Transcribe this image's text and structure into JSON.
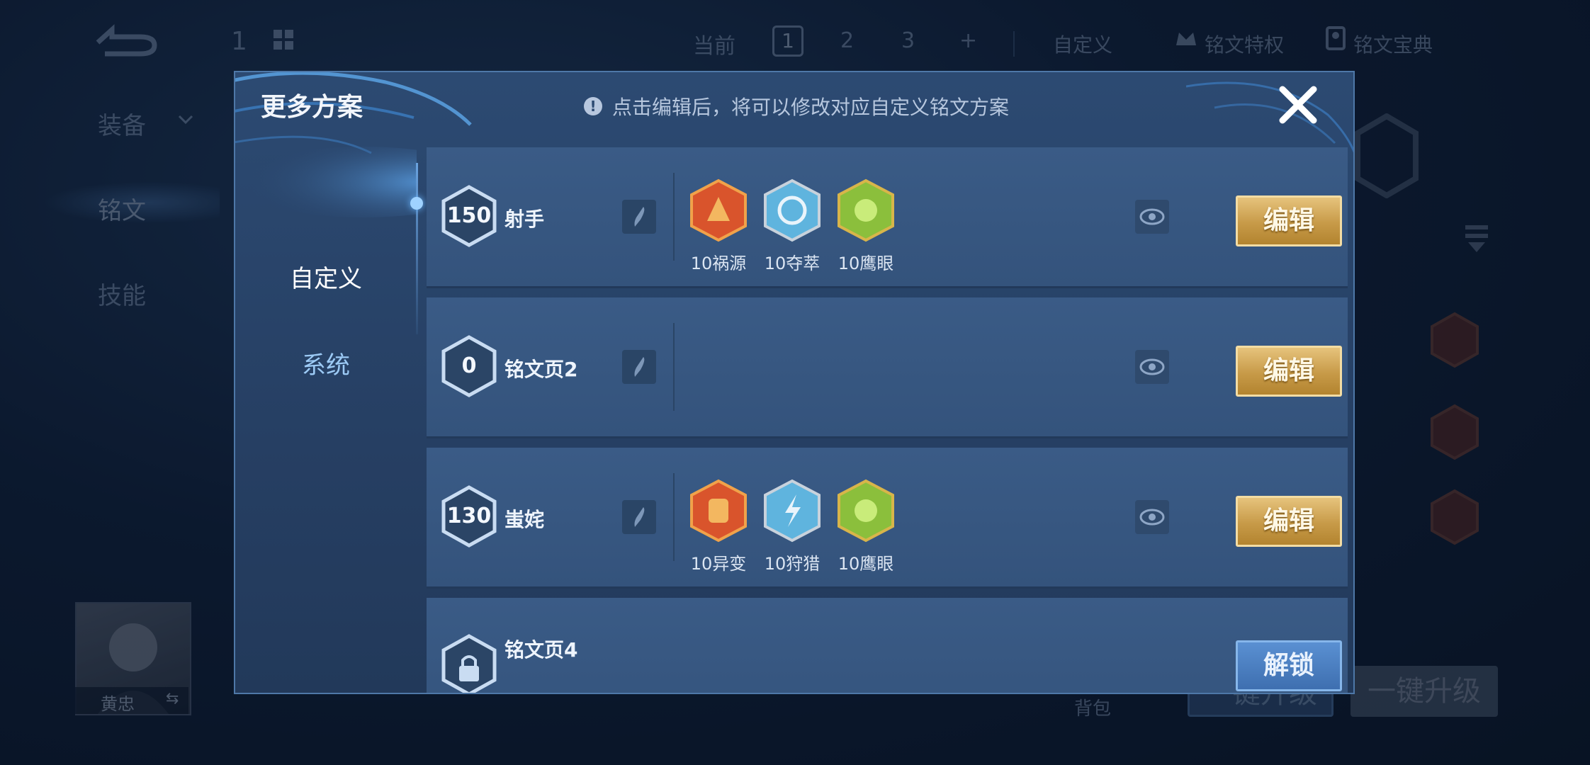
{
  "background": {
    "hero_level": "1",
    "top_label": "当前",
    "scheme_tabs": [
      "1",
      "2",
      "3",
      "+"
    ],
    "custom_label": "自定义",
    "privilege_label": "铭文特权",
    "codex_label": "铭文宝典",
    "left_nav": [
      "装备",
      "铭文",
      "技能"
    ],
    "hero_name": "黄忠",
    "bag_label": "背包",
    "upgrade_label": "一键升级",
    "button_partial": "一键升级"
  },
  "modal": {
    "title": "更多方案",
    "hint": "点击编辑后，将可以修改对应自定义铭文方案",
    "tabs": [
      {
        "label": "自定义",
        "active": true
      },
      {
        "label": "系统",
        "active": false
      }
    ],
    "rows": [
      {
        "level": "150",
        "name": "射手",
        "runes": [
          {
            "label": "10祸源",
            "color": "red",
            "icon": "red-rune-icon"
          },
          {
            "label": "10夺萃",
            "color": "blue",
            "icon": "blue-rune-icon"
          },
          {
            "label": "10鹰眼",
            "color": "green",
            "icon": "green-rune-icon"
          }
        ],
        "action": "编辑",
        "locked": false
      },
      {
        "level": "0",
        "name": "铭文页2",
        "runes": [],
        "action": "编辑",
        "locked": false
      },
      {
        "level": "130",
        "name": "蚩姹",
        "runes": [
          {
            "label": "10异变",
            "color": "red",
            "icon": "red-rune-icon"
          },
          {
            "label": "10狩猎",
            "color": "blue",
            "icon": "blue-rune-icon"
          },
          {
            "label": "10鹰眼",
            "color": "green",
            "icon": "green-rune-icon"
          }
        ],
        "action": "编辑",
        "locked": false
      },
      {
        "level": "",
        "name": "铭文页4",
        "runes": [],
        "action": "解锁",
        "locked": true
      }
    ]
  },
  "colors": {
    "accent_gold": "#c79a48",
    "accent_blue": "#4f7fbf",
    "rune_red": "#d9542c",
    "rune_blue": "#5fb4de",
    "rune_green": "#8bbf3c"
  }
}
